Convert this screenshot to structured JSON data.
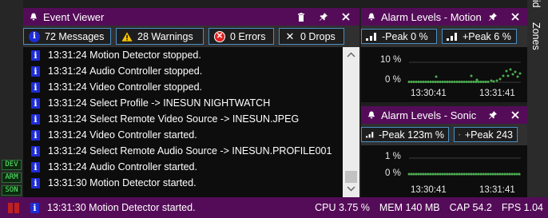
{
  "side_tags": [
    "DEV",
    "ARM",
    "SON"
  ],
  "event_viewer": {
    "title": "Event Viewer",
    "toolbar": {
      "messages": "72 Messages",
      "warnings": "28 Warnings",
      "errors": "0 Errors",
      "drops": "0  Drops"
    },
    "rows": [
      {
        "time": "13:31:24",
        "text": "Motion Detector stopped."
      },
      {
        "time": "13:31:24",
        "text": "Audio Controller stopped."
      },
      {
        "time": "13:31:24",
        "text": "Video Controller stopped."
      },
      {
        "time": "13:31:24",
        "text": "Select Profile -> INESUN NIGHTWATCH"
      },
      {
        "time": "13:31:24",
        "text": "Select Remote Video Source -> INESUN.JPEG"
      },
      {
        "time": "13:31:24",
        "text": "Video Controller started."
      },
      {
        "time": "13:31:24",
        "text": "Select Remote Audio Source -> INESUN.PROFILE001"
      },
      {
        "time": "13:31:24",
        "text": "Audio Controller started."
      },
      {
        "time": "13:31:30",
        "text": "Motion Detector started."
      }
    ]
  },
  "alarm_motion": {
    "title": "Alarm Levels - Motion",
    "neg_peak": "-Peak 0 %",
    "pos_peak": "+Peak 6 %",
    "y_ticks": [
      "10 %",
      "0 %"
    ],
    "x_ticks": [
      "13:30:41",
      "13:31:41"
    ]
  },
  "alarm_sonic": {
    "title": "Alarm Levels - Sonic",
    "neg_peak": "-Peak 123m %",
    "pos_peak": "+Peak 243",
    "y_ticks": [
      "1 %",
      "0 %"
    ],
    "x_ticks": [
      "13:30:41",
      "13:31:41"
    ]
  },
  "side_tabs": [
    "Zones",
    "Grid"
  ],
  "status_bar": {
    "last_event": {
      "time": "13:31:30",
      "text": "Motion Detector started."
    },
    "cpu": "CPU 3.75 %",
    "mem": "MEM 140 MB",
    "cap": "CAP 54.2",
    "fps": "FPS 1.04"
  },
  "colors": {
    "accent": "#540c58",
    "button_border": "#4a8fc4",
    "chart_dots": "#4caf50",
    "info_icon": "#1e2cd6"
  }
}
